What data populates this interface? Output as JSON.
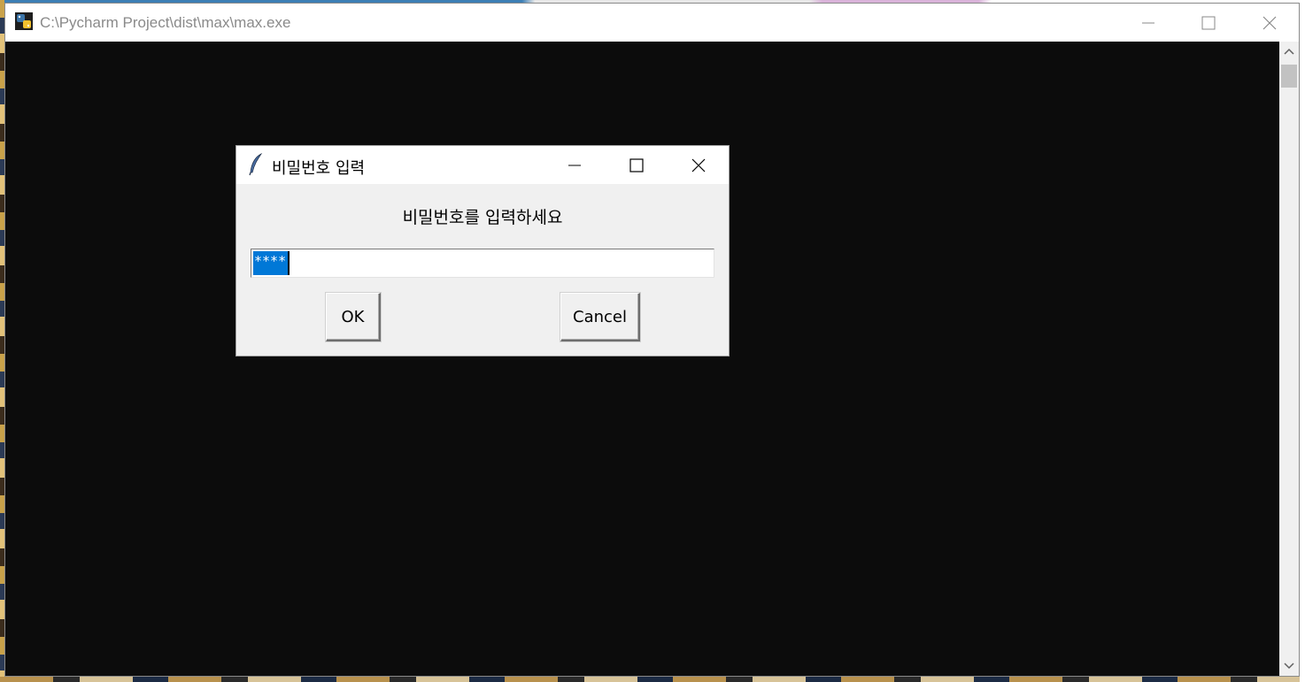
{
  "window": {
    "title": "C:\\Pycharm Project\\dist\\max\\max.exe",
    "icon": "python-exe-icon"
  },
  "dialog": {
    "title": "비밀번호 입력",
    "icon": "tk-feather-icon",
    "prompt": "비밀번호를 입력하세요",
    "password_value": "****",
    "ok_label": "OK",
    "cancel_label": "Cancel"
  },
  "colors": {
    "console_bg": "#0c0c0c",
    "selection": "#0078d7",
    "dialog_bg": "#f0f0f0"
  }
}
